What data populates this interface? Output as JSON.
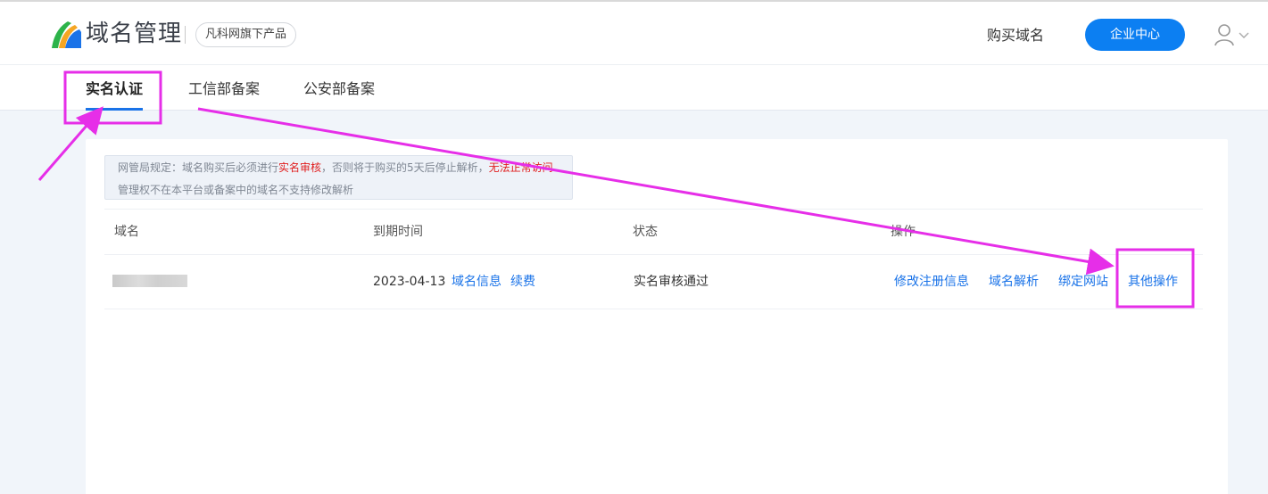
{
  "header": {
    "brand": "域名管理",
    "badge": "凡科网旗下产品",
    "buy_domain": "购买域名",
    "enterprise_center": "企业中心"
  },
  "tabs": [
    {
      "label": "实名认证",
      "active": true
    },
    {
      "label": "工信部备案",
      "active": false
    },
    {
      "label": "公安部备案",
      "active": false
    }
  ],
  "notice": {
    "line1_prefix": "网管局规定：域名购买后必须进行",
    "line1_red1": "实名审核",
    "line1_middle": "，否则将于购买的5天后停止解析，",
    "line1_red2": "无法正常访问",
    "line2": "管理权不在本平台或备案中的域名不支持修改解析"
  },
  "table": {
    "headers": [
      "域名",
      "到期时间",
      "状态",
      "操作"
    ],
    "rows": [
      {
        "expire": "2023-04-13",
        "domain_info": "域名信息",
        "renew": "续费",
        "status": "实名审核通过",
        "actions": [
          "修改注册信息",
          "域名解析",
          "绑定网站",
          "其他操作"
        ]
      }
    ]
  },
  "colors": {
    "accent": "#0c7ff2",
    "link": "#1a73e8",
    "warning_red": "#e02020",
    "annotation_magenta": "#e62ee8"
  },
  "icons": {
    "logo": "logo-icon",
    "user": "user-icon",
    "dropdown": "chevron-down-icon"
  }
}
